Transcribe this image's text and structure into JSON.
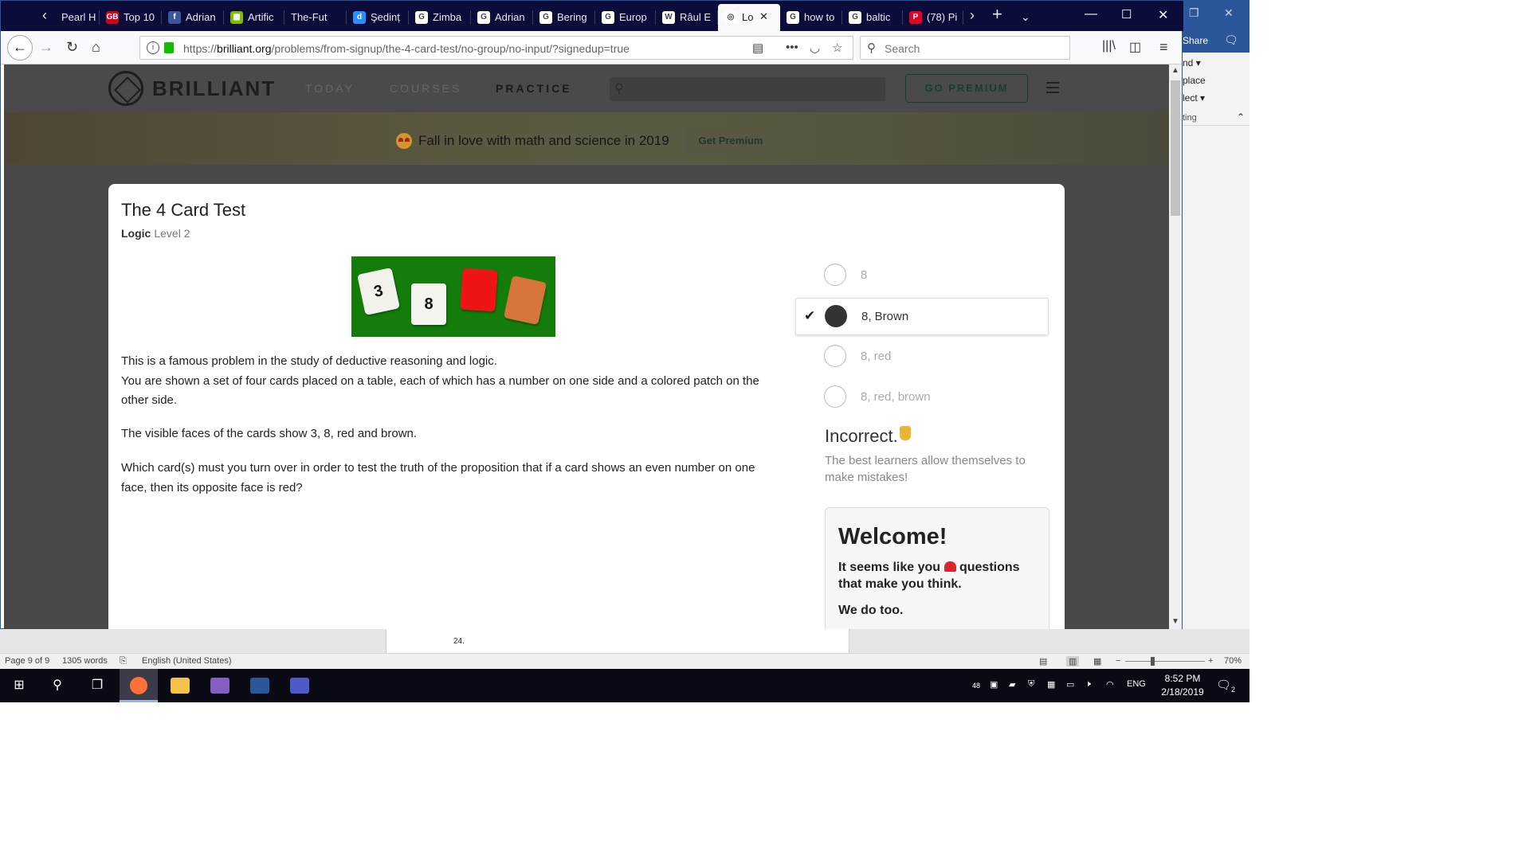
{
  "browser": {
    "tabs": [
      {
        "label": "Pearl H",
        "icon": "page-icon",
        "color": "#0c0c3a"
      },
      {
        "label": "Top 10",
        "icon": "gb-icon",
        "color": "#d0021b"
      },
      {
        "label": "Adrian",
        "icon": "facebook-icon",
        "color": "#3b5998"
      },
      {
        "label": "Artific",
        "icon": "microsoft-icon",
        "color": "#7fba00"
      },
      {
        "label": "The-Future",
        "icon": "page-icon",
        "color": "#0c0c3a"
      },
      {
        "label": "Şedinț",
        "icon": "d-icon",
        "color": "#2d8cff"
      },
      {
        "label": "Zimba",
        "icon": "google-icon",
        "color": "#ffffff"
      },
      {
        "label": "Adrian",
        "icon": "google-icon",
        "color": "#ffffff"
      },
      {
        "label": "Bering",
        "icon": "google-icon",
        "color": "#ffffff"
      },
      {
        "label": "Europ",
        "icon": "google-icon",
        "color": "#ffffff"
      },
      {
        "label": "Râul E",
        "icon": "wikipedia-icon",
        "color": "#ffffff"
      },
      {
        "label": "Lo",
        "icon": "brilliant-icon",
        "color": "#ffffff"
      },
      {
        "label": "how to",
        "icon": "google-icon",
        "color": "#ffffff"
      },
      {
        "label": "baltic",
        "icon": "google-icon",
        "color": "#ffffff"
      },
      {
        "label": "(78) Pi",
        "icon": "pinterest-icon",
        "color": "#e60023"
      }
    ],
    "url_domain": "brilliant.org",
    "url_prefix": "https://",
    "url_path": "/problems/from-signup/the-4-card-test/no-group/no-input/?signedup=true",
    "search_placeholder": "Search"
  },
  "site": {
    "logo": "BRILLIANT",
    "nav": [
      "TODAY",
      "COURSES",
      "PRACTICE"
    ],
    "go_premium": "GO PREMIUM",
    "promo_text": "Fall in love with math and science in 2019",
    "promo_button": "Get Premium"
  },
  "problem": {
    "title": "The 4 Card Test",
    "subject": "Logic",
    "level": "Level 2",
    "cards": [
      "3",
      "8"
    ],
    "paragraphs": [
      "This is a famous problem in the study of deductive reasoning and logic.",
      "You are shown a set of four cards placed on a table, each of which has a number on one side and a colored patch on the other side.",
      "The visible faces of the cards show 3, 8, red and brown.",
      "Which card(s) must you turn over in order to test the truth of the proposition that if a card shows an even number on one face, then its opposite face is red?"
    ],
    "options": [
      "8",
      "8, Brown",
      "8, red",
      "8, red, brown"
    ],
    "selected_option": "8, Brown",
    "verdict": "Incorrect.",
    "verdict_note": "The best learners allow themselves to make mistakes!",
    "welcome_title": "Welcome!",
    "welcome_line1_a": "It seems like you",
    "welcome_line1_b": "questions that make you think.",
    "welcome_line2": "We do too."
  },
  "word": {
    "share": "Share",
    "ribbon": [
      "nd",
      "place",
      "lect",
      "ting"
    ],
    "page_number": "24.",
    "status_page": "Page 9 of 9",
    "status_words": "1305 words",
    "status_lang": "English (United States)",
    "zoom": "70%"
  },
  "taskbar": {
    "clock_time": "8:52 PM",
    "clock_date": "2/18/2019",
    "lang": "ENG",
    "tray_badge": "48",
    "notif_count": "2"
  }
}
